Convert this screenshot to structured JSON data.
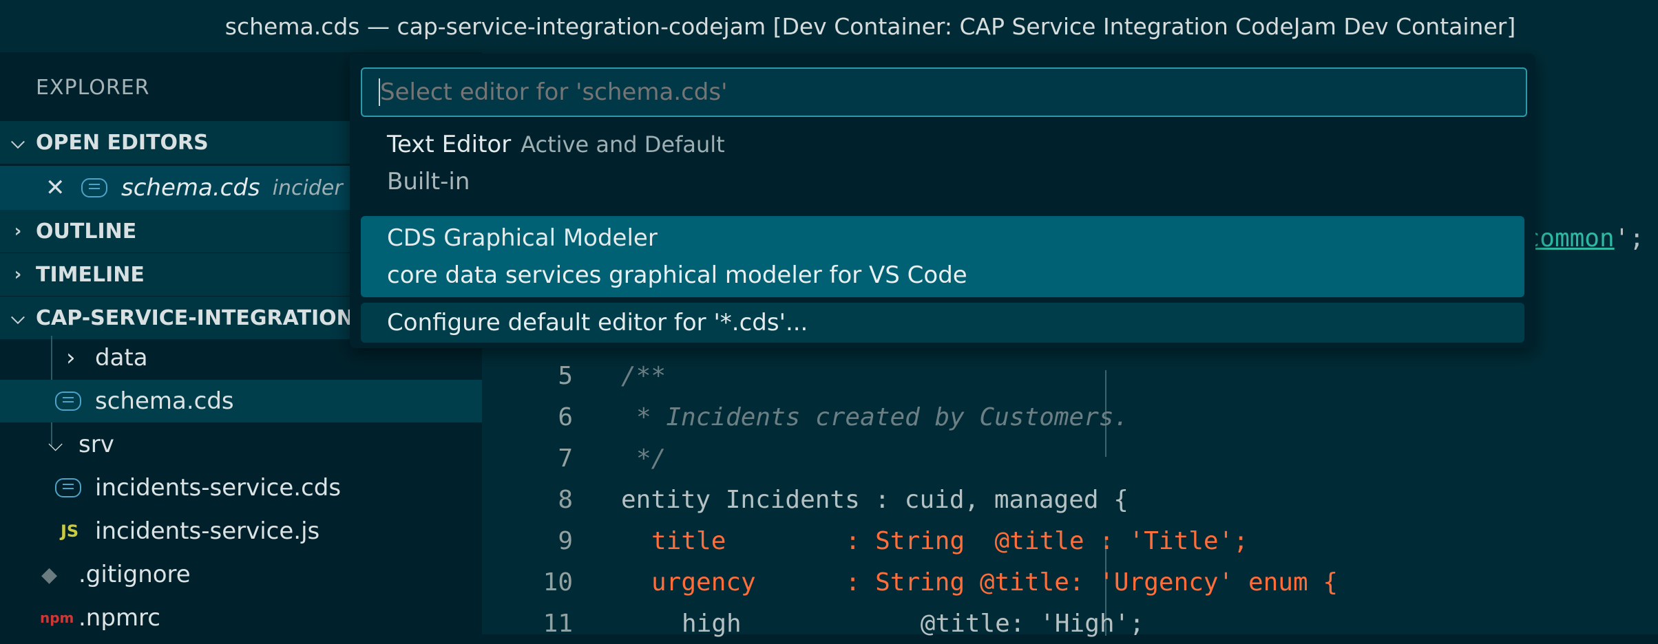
{
  "window": {
    "title": "schema.cds — cap-service-integration-codejam [Dev Container: CAP Service Integration CodeJam Dev Container]"
  },
  "sidebar": {
    "header": "EXPLORER",
    "sections": {
      "open_editors": "OPEN EDITORS",
      "outline": "OUTLINE",
      "timeline": "TIMELINE",
      "project": "CAP-SERVICE-INTEGRATION"
    },
    "open_editor": {
      "file": "schema.cds",
      "path": "incider"
    },
    "tree": [
      {
        "label": "data",
        "kind": "folder-collapsed",
        "icon": "chevron-right-icon"
      },
      {
        "label": "schema.cds",
        "kind": "file",
        "icon": "cds-file-icon"
      },
      {
        "label": "srv",
        "kind": "folder-expanded",
        "icon": "chevron-down-icon"
      },
      {
        "label": "incidents-service.cds",
        "kind": "file",
        "icon": "cds-file-icon"
      },
      {
        "label": "incidents-service.js",
        "kind": "file",
        "icon": "js-file-icon",
        "icon_text": "JS"
      },
      {
        "label": ".gitignore",
        "kind": "file",
        "icon": "git-icon"
      },
      {
        "label": ".npmrc",
        "kind": "file",
        "icon": "npm-icon",
        "icon_text": "npm"
      }
    ]
  },
  "editor": {
    "right_fragment": "common",
    "right_fragment_tail": "';",
    "lines": [
      {
        "num": "5",
        "text": "/**"
      },
      {
        "num": "6",
        "text": "* Incidents created by Customers."
      },
      {
        "num": "7",
        "text": "*/"
      },
      {
        "num": "8",
        "text": "entity Incidents : cuid, managed {"
      },
      {
        "num": "9",
        "text": "title        : String  @title : 'Title';"
      },
      {
        "num": "10",
        "text": "urgency      : String @title: 'Urgency' enum {"
      },
      {
        "num": "11",
        "text": "high            @title: 'High';"
      }
    ]
  },
  "quickpick": {
    "placeholder": "Select editor for 'schema.cds'",
    "items": [
      {
        "title": "Text Editor",
        "detail": "Active and Default",
        "description": "Built-in"
      },
      {
        "title": "CDS Graphical Modeler",
        "description": "core data services graphical modeler for VS Code"
      },
      {
        "title": "Configure default editor for '*.cds'..."
      }
    ]
  },
  "colors": {
    "accent": "#2d9aa9",
    "selection": "#006174",
    "background": "#002b36"
  }
}
